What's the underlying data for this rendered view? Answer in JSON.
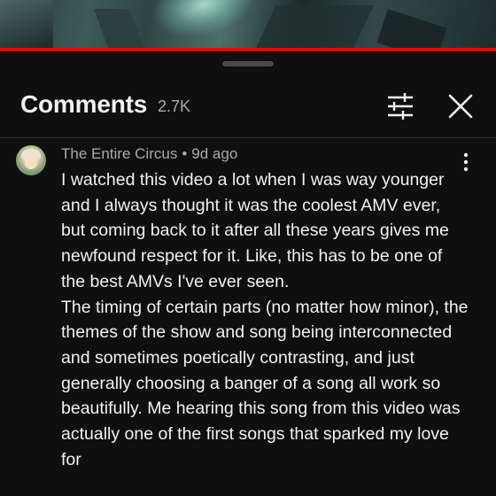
{
  "video": {
    "progress_percent": 100
  },
  "comments_panel": {
    "title": "Comments",
    "count": "2.7K",
    "filter_icon": "sort-filter-icon",
    "close_icon": "close-icon"
  },
  "comment": {
    "author": "The Entire Circus",
    "separator": "•",
    "time": "9d ago",
    "more_icon": "more-vertical-icon",
    "paragraphs": [
      "I watched this video a lot when I was way younger and I always thought it was the coolest AMV ever, but coming back to it after all these years gives me newfound respect for it. Like, this has to be one of the best AMVs I've ever seen.",
      "The timing of certain parts (no matter how minor), the themes of the show and song being interconnected and sometimes poetically contrasting, and just generally choosing a banger of a song all work so beautifully. Me hearing this song from this video was actually one of the first songs that sparked my love for"
    ]
  },
  "colors": {
    "background": "#0f0f0f",
    "progress": "#ff0000",
    "primary_text": "#f1f1f1",
    "secondary_text": "#aaaaaa"
  }
}
